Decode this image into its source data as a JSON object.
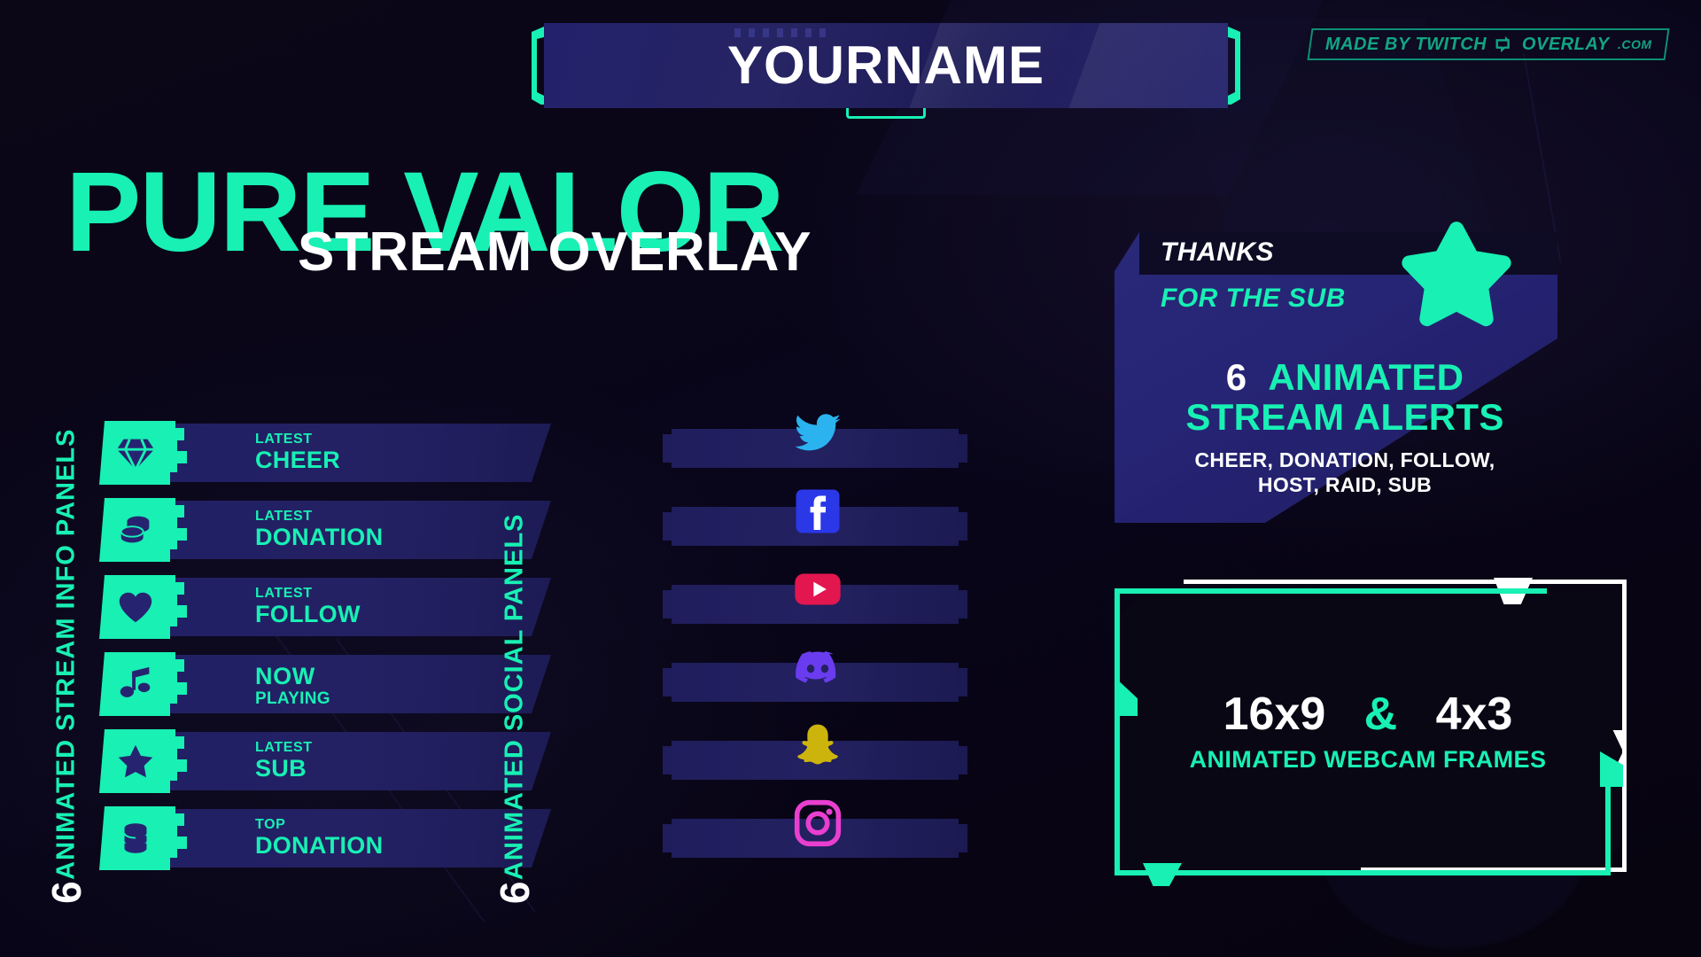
{
  "theme": {
    "accent": "#18f0b4",
    "panel_navy": "#232160",
    "background": "#0a0613",
    "white": "#ffffff"
  },
  "banner": {
    "name": "YOURNAME"
  },
  "madeby": {
    "part1": "MADE BY TWITCH",
    "icon": "twitch-glitch-icon",
    "part2": "OVERLAY",
    "part3": ".COM"
  },
  "hero": {
    "title": "PURE VALOR",
    "subtitle": "STREAM OVERLAY"
  },
  "info_section": {
    "count": "6",
    "label": "ANIMATED STREAM INFO PANELS",
    "panels": [
      {
        "icon": "diamond-icon",
        "small": "LATEST",
        "big": "CHEER",
        "reversed": false
      },
      {
        "icon": "coins-icon",
        "small": "LATEST",
        "big": "DONATION",
        "reversed": false
      },
      {
        "icon": "heart-icon",
        "small": "LATEST",
        "big": "FOLLOW",
        "reversed": false
      },
      {
        "icon": "music-note-icon",
        "small": "NOW",
        "big": "PLAYING",
        "reversed": true
      },
      {
        "icon": "star-icon",
        "small": "LATEST",
        "big": "SUB",
        "reversed": false
      },
      {
        "icon": "coins-icon",
        "small": "TOP",
        "big": "DONATION",
        "reversed": false
      }
    ]
  },
  "social_section": {
    "count": "6",
    "label": "ANIMATED SOCIAL PANELS",
    "panels": [
      {
        "icon": "twitter-icon",
        "color": "#2ab3ef"
      },
      {
        "icon": "facebook-icon",
        "color": "#2a38e8"
      },
      {
        "icon": "youtube-icon",
        "color": "#e3164f"
      },
      {
        "icon": "discord-icon",
        "color": "#6a3cf0"
      },
      {
        "icon": "snapchat-icon",
        "color": "#cdb40d"
      },
      {
        "icon": "instagram-icon",
        "color": "#e93fd0"
      }
    ]
  },
  "alerts_section": {
    "alert_preview": {
      "title": "THANKS",
      "subtitle": "FOR THE SUB",
      "icon": "star-icon"
    },
    "count": "6",
    "headline_accent": "ANIMATED",
    "headline_line2": "STREAM ALERTS",
    "list_line1": "CHEER, DONATION, FOLLOW,",
    "list_line2": "HOST, RAID, SUB"
  },
  "webcam_section": {
    "ratio_a": "16x9",
    "ampersand": "&",
    "ratio_b": "4x3",
    "caption": "ANIMATED WEBCAM FRAMES"
  }
}
